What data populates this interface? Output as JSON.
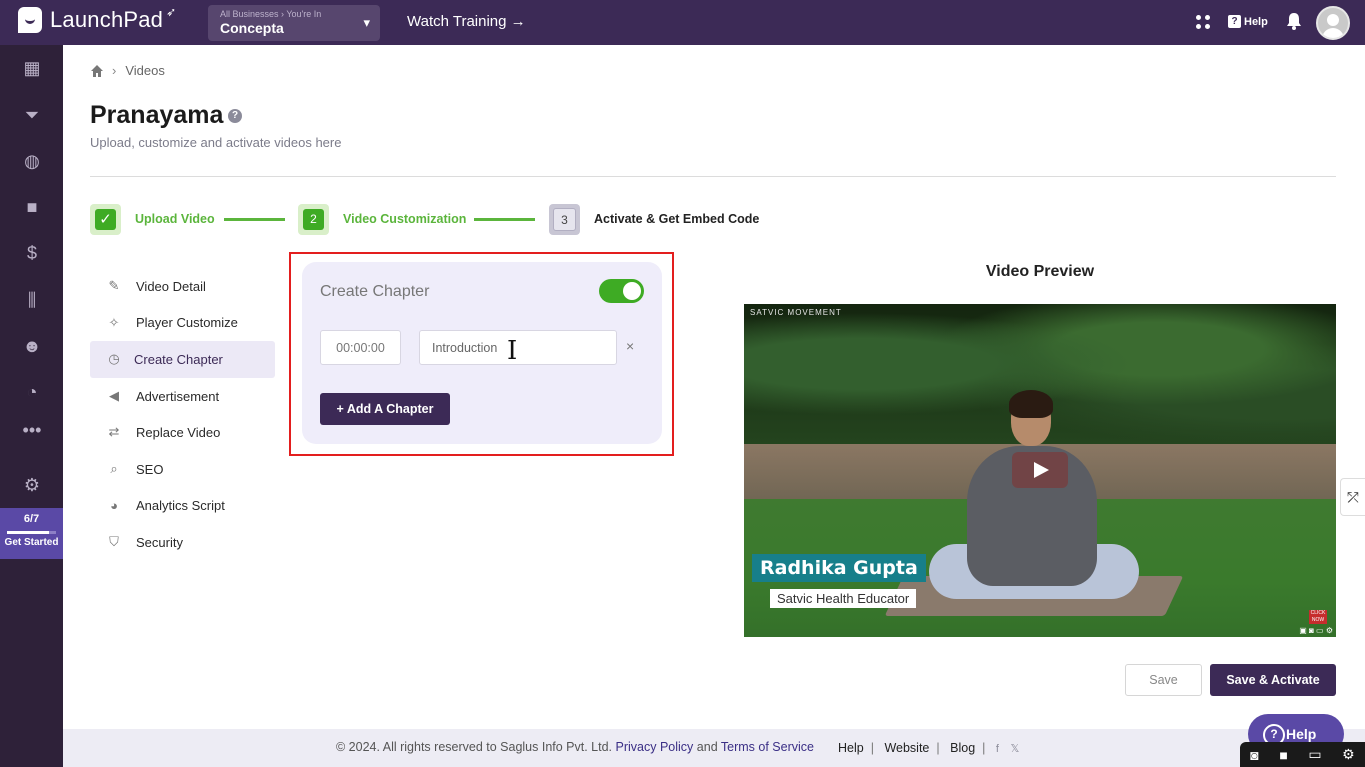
{
  "app": {
    "name": "LaunchPad"
  },
  "business": {
    "prefix": "All Businesses › You're In",
    "name": "Concepta"
  },
  "topbar": {
    "watch_training": "Watch Training →",
    "help": "Help"
  },
  "sidebar": {
    "icons": [
      "dashboard-icon",
      "funnel-icon",
      "globe-icon",
      "video-icon",
      "dollar-icon",
      "analytics-icon",
      "users-icon",
      "gauge-icon",
      "more-icon",
      "settings-icon"
    ],
    "progress": {
      "fraction": "6/7",
      "value": 0.857,
      "label": "Get Started"
    }
  },
  "breadcrumb": {
    "current": "Videos"
  },
  "page": {
    "title": "Pranayama",
    "subtitle": "Upload, customize and activate videos here"
  },
  "steps": [
    {
      "number": "✓",
      "label": "Upload Video",
      "state": "done"
    },
    {
      "number": "2",
      "label": "Video Customization",
      "state": "active"
    },
    {
      "number": "3",
      "label": "Activate & Get Embed Code",
      "state": "todo"
    }
  ],
  "menu": [
    {
      "label": "Video Detail",
      "icon": "edit-icon"
    },
    {
      "label": "Player Customize",
      "icon": "wand-icon"
    },
    {
      "label": "Create Chapter",
      "icon": "timer-icon",
      "active": true
    },
    {
      "label": "Advertisement",
      "icon": "megaphone-icon"
    },
    {
      "label": "Replace Video",
      "icon": "swap-icon"
    },
    {
      "label": "SEO",
      "icon": "search-icon"
    },
    {
      "label": "Analytics Script",
      "icon": "chart-pie-icon"
    },
    {
      "label": "Security",
      "icon": "shield-icon"
    }
  ],
  "chapter": {
    "title": "Create Chapter",
    "enabled": true,
    "time_value": "00:00:00",
    "name_value": "Introduction",
    "remove": "×",
    "add_label": "+ Add A Chapter"
  },
  "preview": {
    "title": "Video Preview",
    "brand": "SATVIC MOVEMENT",
    "lower_third_name": "Radhika Gupta",
    "lower_third_role": "Satvic Health Educator",
    "cta": "CLICK NOW"
  },
  "actions": {
    "save": "Save",
    "save_activate": "Save & Activate"
  },
  "footer": {
    "copyright": "©  2024. All rights reserved to Saglus Info Pvt. Ltd.",
    "privacy": "Privacy Policy",
    "and": "and",
    "terms": "Terms of Service",
    "help": "Help",
    "website": "Website",
    "blog": "Blog",
    "facebook": "f",
    "x": "𝕏"
  },
  "help_widget": {
    "label": "Help"
  },
  "colors": {
    "brand_dark": "#3c2a56",
    "accent_green": "#3eab24",
    "highlight_red": "#e31e1e"
  }
}
